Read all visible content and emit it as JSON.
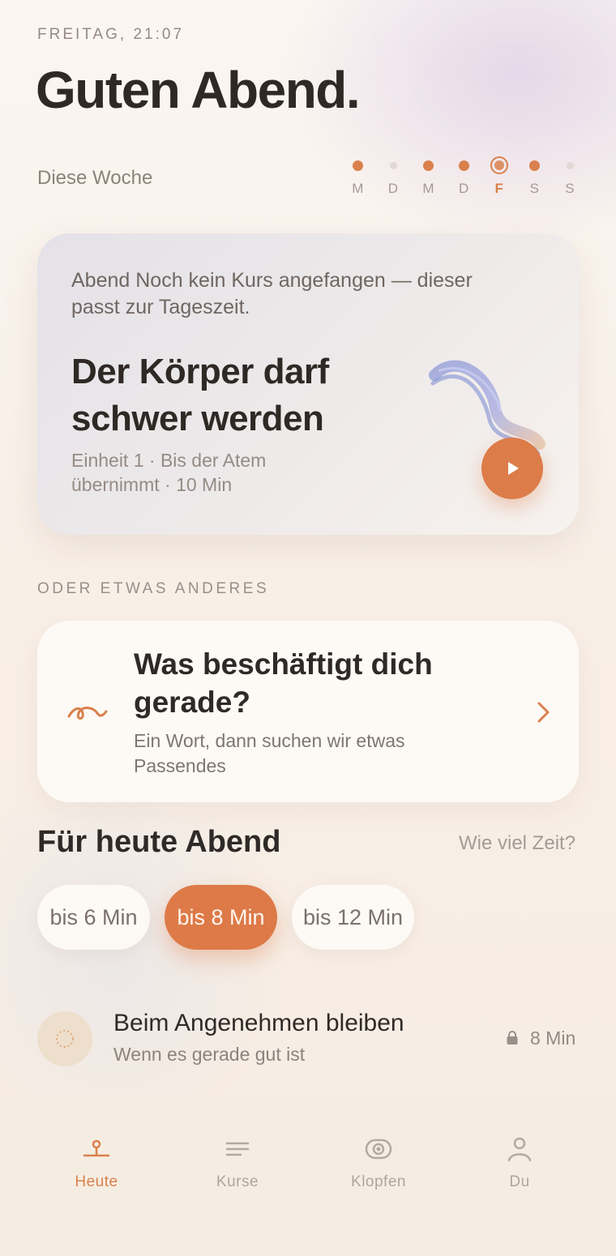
{
  "header": {
    "date": "FREITAG, 21:07",
    "greeting": "Guten Abend."
  },
  "week": {
    "label": "Diese Woche",
    "days": [
      {
        "letter": "M",
        "state": "done"
      },
      {
        "letter": "D",
        "state": "empty"
      },
      {
        "letter": "M",
        "state": "done"
      },
      {
        "letter": "D",
        "state": "done"
      },
      {
        "letter": "F",
        "state": "today"
      },
      {
        "letter": "S",
        "state": "done"
      },
      {
        "letter": "S",
        "state": "empty"
      }
    ]
  },
  "hero": {
    "subtitle": "Abend Noch kein Kurs angefangen — dieser passt zur Tageszeit.",
    "title": "Der Körper darf schwer werden",
    "meta": "Einheit 1 · Bis der Atem übernimmt · 10 Min",
    "play_icon": "play-icon"
  },
  "section": {
    "other_label": "ODER ETWAS ANDERES"
  },
  "ask": {
    "title": "Was beschäftigt dich gerade?",
    "subtitle": "Ein Wort, dann suchen wir etwas Passendes",
    "icon": "squiggle-icon"
  },
  "tonight": {
    "title": "Für heute Abend",
    "time_link": "Wie viel Zeit?",
    "chips": [
      "bis 6 Min",
      "bis 8 Min",
      "bis 12 Min"
    ],
    "selected_chip": "bis 8 Min"
  },
  "item": {
    "title": "Beim Angenehmen bleiben",
    "subtitle": "Wenn es gerade gut ist",
    "duration": "8 Min",
    "locked": true
  },
  "tabs": [
    {
      "label": "Heute",
      "icon": "today-icon",
      "active": true
    },
    {
      "label": "Kurse",
      "icon": "courses-icon",
      "active": false
    },
    {
      "label": "Klopfen",
      "icon": "tapping-icon",
      "active": false
    },
    {
      "label": "Du",
      "icon": "profile-icon",
      "active": false
    }
  ],
  "colors": {
    "accent": "#dc7c49",
    "text": "#2f2a27",
    "muted": "#958b85",
    "tab_background": "#f6ede2"
  }
}
